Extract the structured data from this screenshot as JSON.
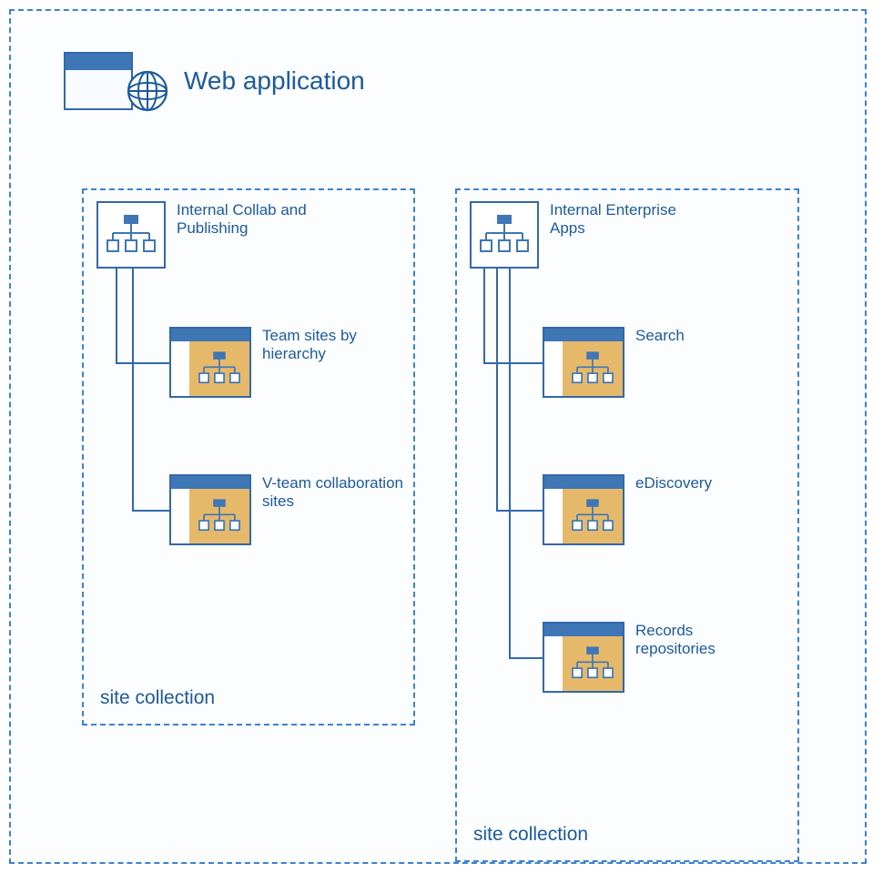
{
  "webapp": {
    "title": "Web application"
  },
  "collections": [
    {
      "label": "site collection",
      "root": {
        "label": "Internal Collab and Publishing"
      },
      "children": [
        {
          "label": "Team sites by hierarchy"
        },
        {
          "label": "V-team collaboration sites"
        }
      ]
    },
    {
      "label": "site collection",
      "root": {
        "label": "Internal Enterprise Apps"
      },
      "children": [
        {
          "label": "Search"
        },
        {
          "label": "eDiscovery"
        },
        {
          "label": "Records repositories"
        }
      ]
    }
  ]
}
